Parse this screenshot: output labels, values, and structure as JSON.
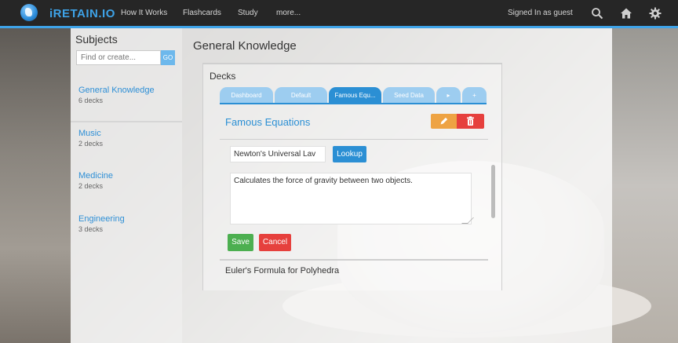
{
  "app": {
    "brand": "iRETAIN.IO",
    "nav": [
      "How It Works",
      "Flashcards",
      "Study",
      "more..."
    ],
    "signed_in": "Signed In as guest",
    "icons": [
      "search-icon",
      "home-icon",
      "gear-icon"
    ],
    "accent_color": "#3ea3e8"
  },
  "sidebar": {
    "title": "Subjects",
    "search_placeholder": "Find or create...",
    "go_label": "GO",
    "subjects": [
      {
        "name": "General Knowledge",
        "count": "6 decks"
      },
      {
        "name": "Music",
        "count": "2 decks"
      },
      {
        "name": "Medicine",
        "count": "2 decks"
      },
      {
        "name": "Engineering",
        "count": "3 decks"
      }
    ]
  },
  "main": {
    "title": "General Knowledge",
    "decks_label": "Decks",
    "tabs": [
      "Dashboard",
      "Default",
      "Famous Equ...",
      "Seed Data",
      "▸",
      "+"
    ],
    "active_tab": "Famous Equ...",
    "deck_name": "Famous Equations",
    "card": {
      "front_value": "Newton's Universal Lav",
      "lookup_label": "Lookup",
      "back_value": "Calculates the force of gravity between two objects.",
      "save_label": "Save",
      "cancel_label": "Cancel"
    },
    "next_card": "Euler's Formula for Polyhedra"
  }
}
